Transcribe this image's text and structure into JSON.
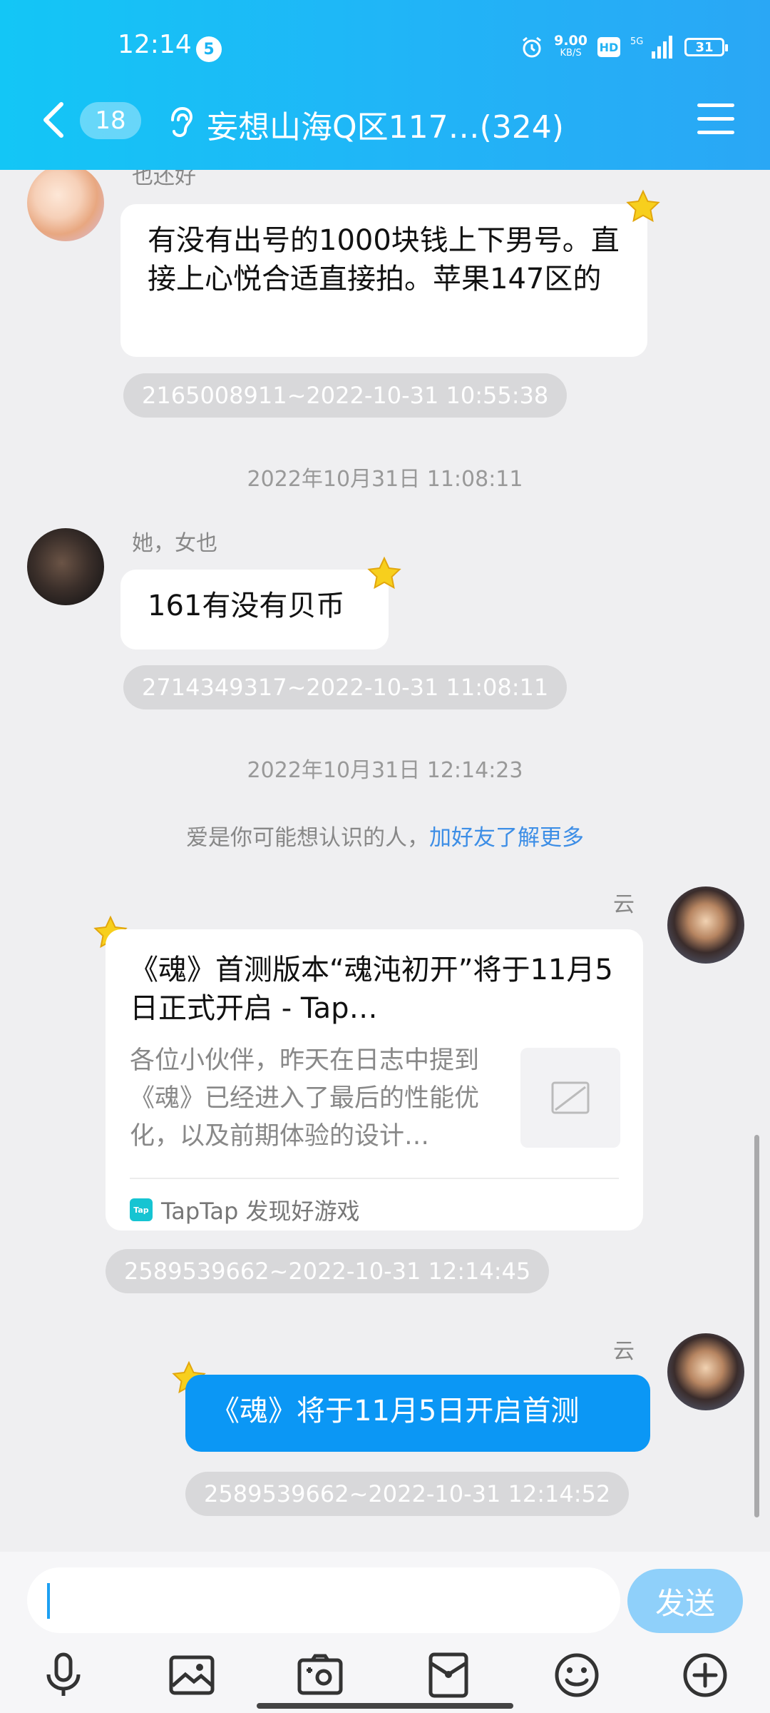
{
  "status_bar": {
    "time": "12:14",
    "notification_count": "5",
    "net_speed": "9.00",
    "net_speed_unit": "KB/S",
    "hd": "HD",
    "signal_label": "5G",
    "battery": "31"
  },
  "header": {
    "unread_count": "18",
    "title": "妄想山海Q区117…(324)"
  },
  "messages": [
    {
      "sender": "也还好",
      "text": "有没有出号的1000块钱上下男号。直接上心悦合适直接拍。苹果147区的",
      "meta": "2165008911~2022-10-31 10:55:38"
    },
    {
      "sender": "她，女也",
      "text": "161有没有贝币",
      "meta": "2714349317~2022-10-31 11:08:11"
    }
  ],
  "time_dividers": [
    "2022年10月31日 11:08:11",
    "2022年10月31日 12:14:23"
  ],
  "system_message": {
    "text": "爱是你可能想认识的人，",
    "link": "加好友了解更多"
  },
  "share_card": {
    "sender": "云",
    "title": "《魂》首测版本“魂沌初开”将于11月5日正式开启 - Tap…",
    "description": "各位小伙伴，昨天在日志中提到《魂》已经进入了最后的性能优化，以及前期体验的设计…",
    "source": "TapTap 发现好游戏",
    "source_icon_text": "Tap",
    "meta": "2589539662~2022-10-31 12:14:45"
  },
  "self_message": {
    "sender": "云",
    "text": "《魂》将于11月5日开启首测",
    "meta": "2589539662~2022-10-31 12:14:52"
  },
  "input": {
    "placeholder": "",
    "send_label": "发送"
  },
  "toolbar": [
    "microphone-icon",
    "image-icon",
    "camera-icon",
    "red-packet-icon",
    "emoji-icon",
    "plus-icon"
  ],
  "colors": {
    "header_start": "#13c6f6",
    "header_end": "#2aa7f5",
    "self_bubble": "#0b97f5",
    "send_button": "#8fd0fa",
    "link": "#3d8ee6"
  }
}
